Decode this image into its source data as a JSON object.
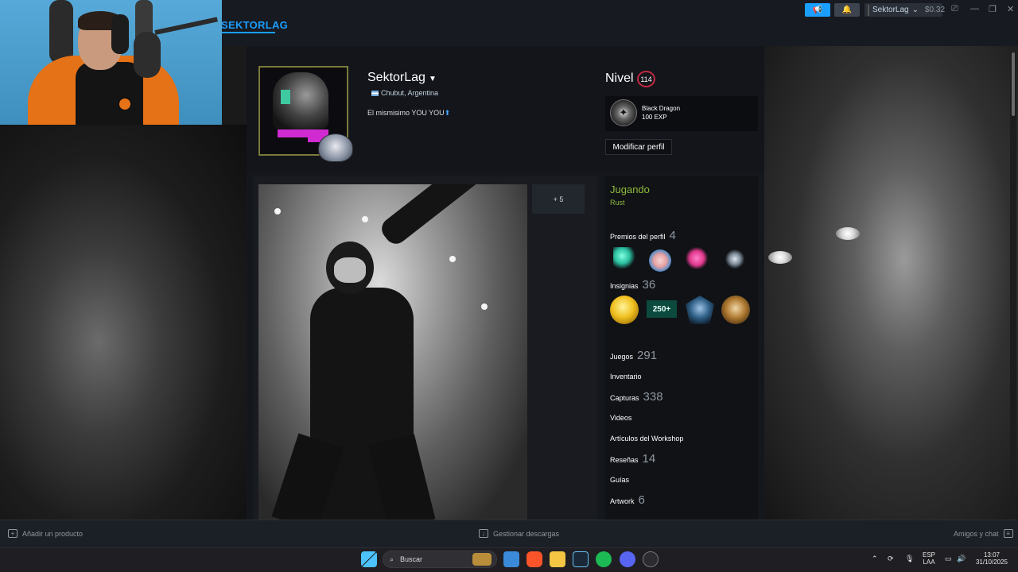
{
  "header": {
    "nav_active": "SEKTORLAG",
    "account_name": "SektorLag",
    "account_caret": "⌄",
    "wallet": "$0.32",
    "window_controls": [
      "⎚",
      "—",
      "❐",
      "✕"
    ]
  },
  "profile": {
    "persona_name": "SektorLag",
    "location": "Chubut, Argentina",
    "summary": "El mismisimo YOU YOU",
    "level_label": "Nivel",
    "level": "114",
    "featured_badge": {
      "name": "Black Dragon",
      "exp": "100 EXP"
    },
    "edit_button": "Modificar perfil"
  },
  "showcase": {
    "more_label": "+ 5"
  },
  "sidebar": {
    "status": "Jugando",
    "game": "Rust",
    "awards": {
      "label": "Premios del perfil",
      "count": "4"
    },
    "badges": {
      "label": "Insignias",
      "count": "36",
      "level_badge_text": "250+"
    },
    "links": [
      {
        "label": "Juegos",
        "count": "291"
      },
      {
        "label": "Inventario",
        "count": ""
      },
      {
        "label": "Capturas",
        "count": "338"
      },
      {
        "label": "Videos",
        "count": ""
      },
      {
        "label": "Artículos del Workshop",
        "count": ""
      },
      {
        "label": "Reseñas",
        "count": "14"
      },
      {
        "label": "Guías",
        "count": ""
      },
      {
        "label": "Artwork",
        "count": "6"
      }
    ]
  },
  "footer": {
    "add_product": "Añadir un producto",
    "downloads": "Gestionar descargas",
    "friends": "Amigos y chat"
  },
  "taskbar": {
    "search_placeholder": "Buscar",
    "lang_line1": "ESP",
    "lang_line2": "LAA",
    "time": "13:07",
    "date": "31/10/2025"
  }
}
